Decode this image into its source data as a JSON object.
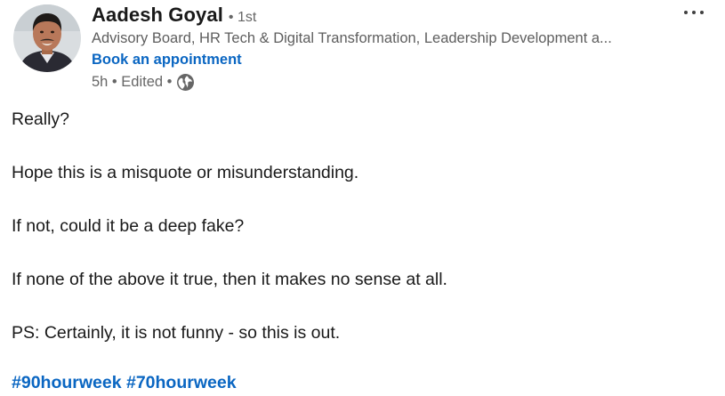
{
  "post": {
    "author": {
      "name": "Aadesh Goyal",
      "degree": "• 1st",
      "headline": "Advisory Board, HR Tech & Digital Transformation, Leadership Development a...",
      "cta": "Book an appointment",
      "meta": "5h • Edited •",
      "visibility_icon": "globe-icon",
      "avatar_icon": "profile-photo"
    },
    "more_icon": "ellipsis-icon",
    "body": {
      "lines": [
        "Really?",
        "Hope this is a misquote or misunderstanding.",
        "If not, could it be a deep fake?",
        "If none of the above it true, then it makes no sense at all.",
        "PS: Certainly, it is not funny - so this is out."
      ]
    },
    "hashtags": [
      "#90hourweek",
      "#70hourweek"
    ]
  },
  "colors": {
    "link": "#0a66c2",
    "text": "#191919",
    "secondary": "#666666"
  }
}
